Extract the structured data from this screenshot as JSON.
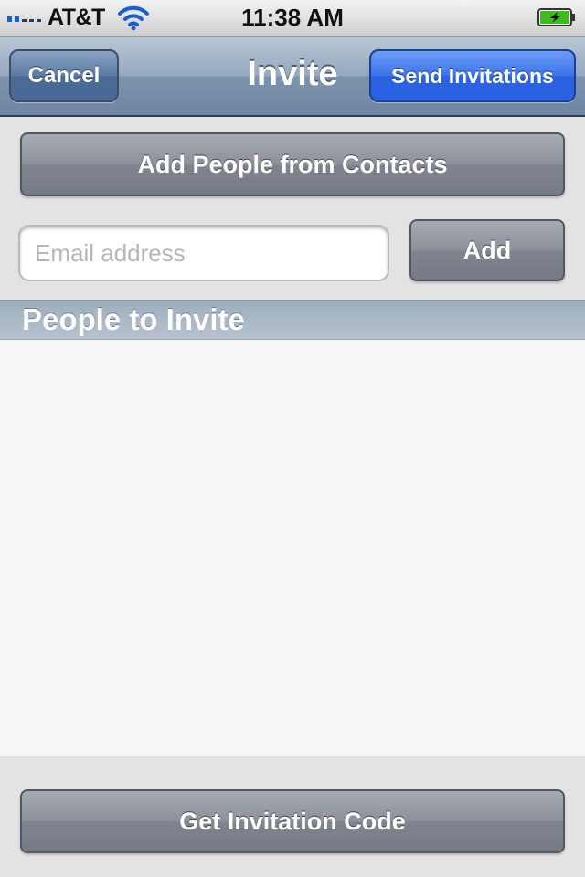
{
  "status_bar": {
    "carrier": "AT&T",
    "time": "11:38 AM",
    "icons": [
      "signal-bars-icon",
      "wifi-icon",
      "battery-charging-icon"
    ],
    "battery_color": "#3dbb1f"
  },
  "nav": {
    "title": "Invite",
    "cancel_label": "Cancel",
    "send_label": "Send Invitations"
  },
  "form": {
    "contacts_button_label": "Add People from Contacts",
    "email_placeholder": "Email address",
    "email_value": "",
    "add_button_label": "Add"
  },
  "invite_section": {
    "header": "People to Invite",
    "people": []
  },
  "footer": {
    "code_button_label": "Get Invitation Code"
  },
  "colors": {
    "nav_blue": "#6e86a3",
    "send_blue": "#2a63e2",
    "button_gray": "#80848e"
  }
}
